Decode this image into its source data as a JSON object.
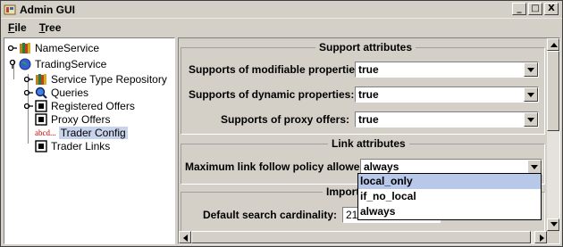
{
  "window": {
    "title": "Admin GUI",
    "controls": [
      "_",
      "□",
      "X"
    ]
  },
  "menubar": [
    {
      "label": "File",
      "mnemonic": "F",
      "rest": "ile"
    },
    {
      "label": "Tree",
      "mnemonic": "T",
      "rest": "ree"
    }
  ],
  "tree": {
    "nodes": [
      {
        "label": "NameService",
        "icon": "books-icon"
      },
      {
        "label": "TradingService",
        "icon": "globe-icon"
      },
      {
        "label": "Service Type Repository",
        "icon": "books-icon"
      },
      {
        "label": "Queries",
        "icon": "magnifier-icon"
      },
      {
        "label": "Registered Offers",
        "icon": "document-icon"
      },
      {
        "label": "Proxy Offers",
        "icon": "document-icon"
      },
      {
        "label": "Trader Config",
        "icon": "text-abcd-icon",
        "icon_text": "abcd...",
        "selected": true
      },
      {
        "label": "Trader Links",
        "icon": "document-icon"
      }
    ]
  },
  "support_attributes": {
    "title": "Support attributes",
    "rows": [
      {
        "label": "Supports of modifiable properties:",
        "value": "true"
      },
      {
        "label": "Supports of dynamic properties:",
        "value": "true"
      },
      {
        "label": "Supports of proxy offers:",
        "value": "true"
      }
    ]
  },
  "link_attributes": {
    "title": "Link attributes",
    "max_link_label": "Maximum link follow policy allowed:",
    "max_link_value": "always",
    "options": [
      "local_only",
      "if_no_local",
      "always"
    ],
    "highlighted_option": "local_only"
  },
  "import_attributes": {
    "title": "Import",
    "default_search_label": "Default search cardinality:",
    "default_search_value": "21"
  },
  "colors": {
    "selection": "#b8c8e8",
    "tree_selection": "#c8d4ec",
    "chrome": "#d4d0c8"
  }
}
